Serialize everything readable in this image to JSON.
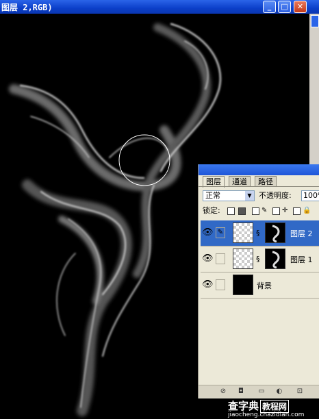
{
  "window": {
    "title": "图层 2,RGB)",
    "minimize": "_",
    "maximize": "□",
    "close": "✕"
  },
  "panel": {
    "tabs": [
      {
        "label": "图层"
      },
      {
        "label": "通道"
      },
      {
        "label": "路径"
      }
    ],
    "blend_mode": "正常",
    "opacity_label": "不透明度:",
    "opacity_value": "100%",
    "lock_label": "锁定:",
    "layers": [
      {
        "name": "图层 2",
        "visible": true,
        "selected": true
      },
      {
        "name": "图层 1",
        "visible": true,
        "selected": false
      },
      {
        "name": "背景",
        "visible": true,
        "selected": false
      }
    ]
  },
  "watermark": {
    "main": "查字典",
    "boxed": "教程网",
    "url": "jiaocheng.chazidian.com"
  }
}
